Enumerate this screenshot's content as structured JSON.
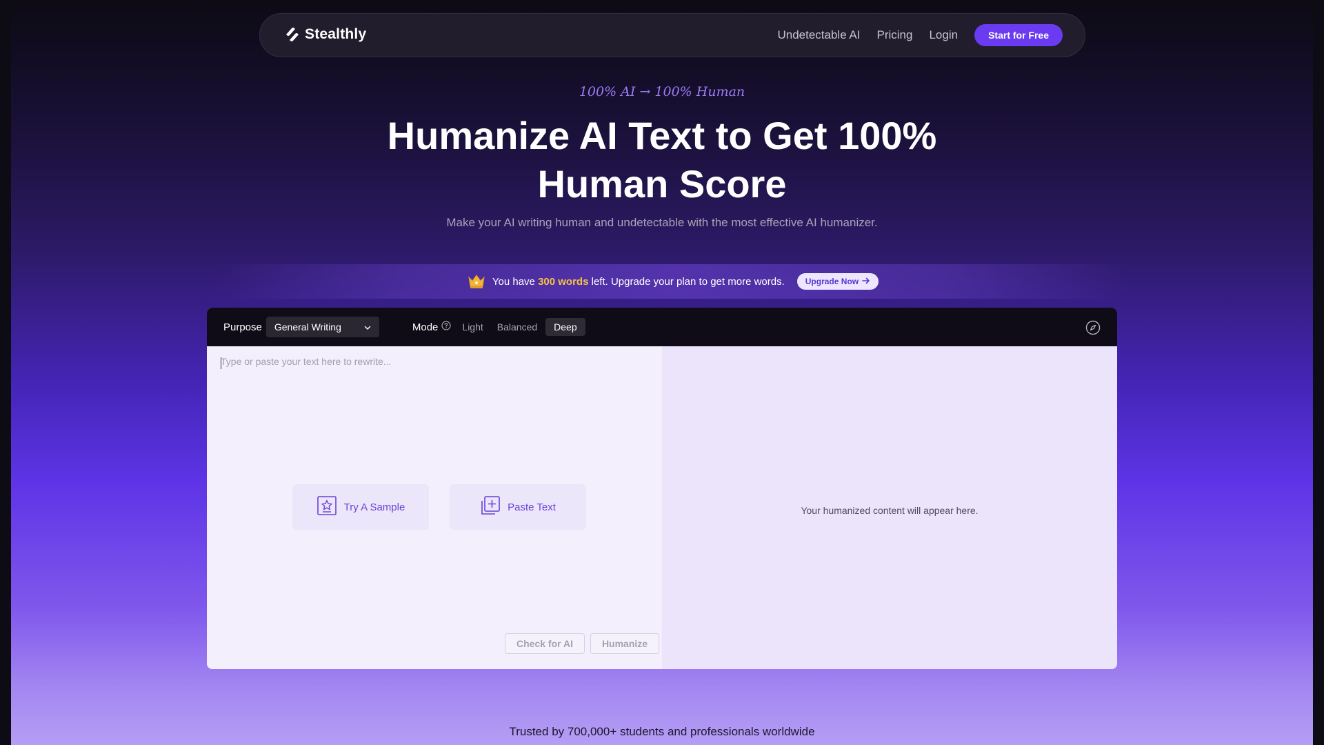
{
  "nav": {
    "logo_text": "Stealthly",
    "links": [
      "Undetectable AI",
      "Pricing",
      "Login"
    ],
    "cta_label": "Start for Free"
  },
  "hero": {
    "tagline": "100% AI → 100% Human",
    "title_line1": "Humanize AI Text to Get 100%",
    "title_line2": "Human Score",
    "subtitle": "Make your AI writing human and undetectable with the most effective AI humanizer."
  },
  "banner": {
    "prefix": "You have",
    "highlight": "300 words",
    "suffix": "left. Upgrade your plan to get more words.",
    "button_label": "Upgrade Now"
  },
  "editor": {
    "purpose_label": "Purpose",
    "purpose_value": "General Writing",
    "mode_label": "Mode",
    "modes": [
      "Light",
      "Balanced",
      "Deep"
    ],
    "active_mode": "Deep",
    "input_placeholder": "Type or paste your text here to rewrite...",
    "sample_label": "Try A Sample",
    "paste_label": "Paste Text",
    "check_label": "Check for AI",
    "humanize_label": "Humanize",
    "output_placeholder": "Your humanized content will appear here."
  },
  "footer": {
    "trusted_text": "Trusted by 700,000+ students and professionals worldwide"
  },
  "colors": {
    "accent": "#6a3bf0",
    "highlight": "#f5c542"
  }
}
